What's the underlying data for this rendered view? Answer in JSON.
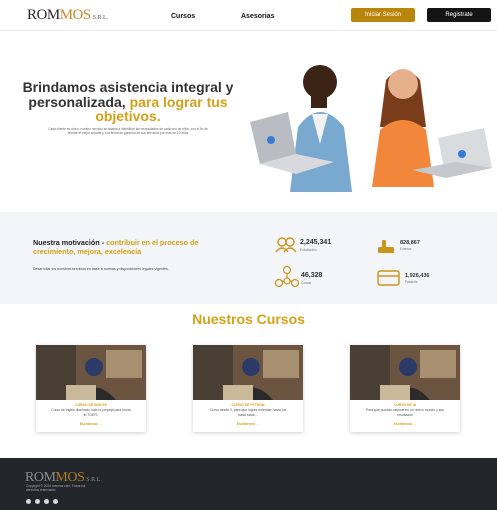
{
  "header": {
    "logo": {
      "main_a": "ROM",
      "main_b": "MOS",
      "suffix": "S.R.L."
    },
    "nav": [
      {
        "label": "Cursos"
      },
      {
        "label": "Asesorias"
      }
    ],
    "login_label": "Iniciar Sesión",
    "register_label": "Registrate"
  },
  "hero": {
    "title_a": "Brindamos asistencia integral y personalizada,",
    "title_b": "para lograr tus objetivos.",
    "subtitle": "Cada cliente es único, nuestro servicio se adapta a identificar las necesidades de cada uno de ellos, con el fin de brindar el mejor soporte y a la fecha de garantía de sus servicios por más de 10 años"
  },
  "motivation": {
    "title_a": "Nuestra motivación -",
    "title_b": "contribuir en el proceso de crecimiento, mejora, excelencia",
    "text": "Desarrollar los nuestros servicios en base a normas y disposiciones legales vigentes."
  },
  "stats": [
    {
      "value": "2,245,341",
      "label": "Estudiantes",
      "icon": "users-icon"
    },
    {
      "value": "828,867",
      "label": "Eventos",
      "icon": "hand-icon"
    },
    {
      "value": "46,328",
      "label": "Cursos",
      "icon": "network-icon"
    },
    {
      "value": "1,926,436",
      "label": "Pasarela",
      "icon": "card-icon"
    }
  ],
  "courses": {
    "title": "Nuestros Cursos",
    "items": [
      {
        "name": "CURSO DE INGLES",
        "desc": "Curso de inglés diseñado, sale la prepapt para tomar el TOEFL",
        "link": "Escríbenos →"
      },
      {
        "name": "CURSO DE PYTHON",
        "desc": "Curso desde 0, para que logres entender hasta los basic stack...",
        "link": "Escríbenos →"
      },
      {
        "name": "CURSO DE IA",
        "desc": "Para que puedas mejorar en un nuevo mundo y sus resultados",
        "link": "Escríbenos →"
      }
    ]
  },
  "footer": {
    "logo": {
      "main_a": "ROM",
      "main_b": "MOS",
      "suffix": "S.R.L."
    },
    "text": "Copyright © 2024 rommos.com, Todos los derechos reservados",
    "social": [
      "instagram-icon",
      "facebook-icon",
      "twitter-icon",
      "youtube-icon"
    ]
  },
  "colors": {
    "accent": "#d4a017",
    "login": "#b8860b",
    "dark": "#141414",
    "footer": "#22262b",
    "band": "#f4f5f8"
  }
}
